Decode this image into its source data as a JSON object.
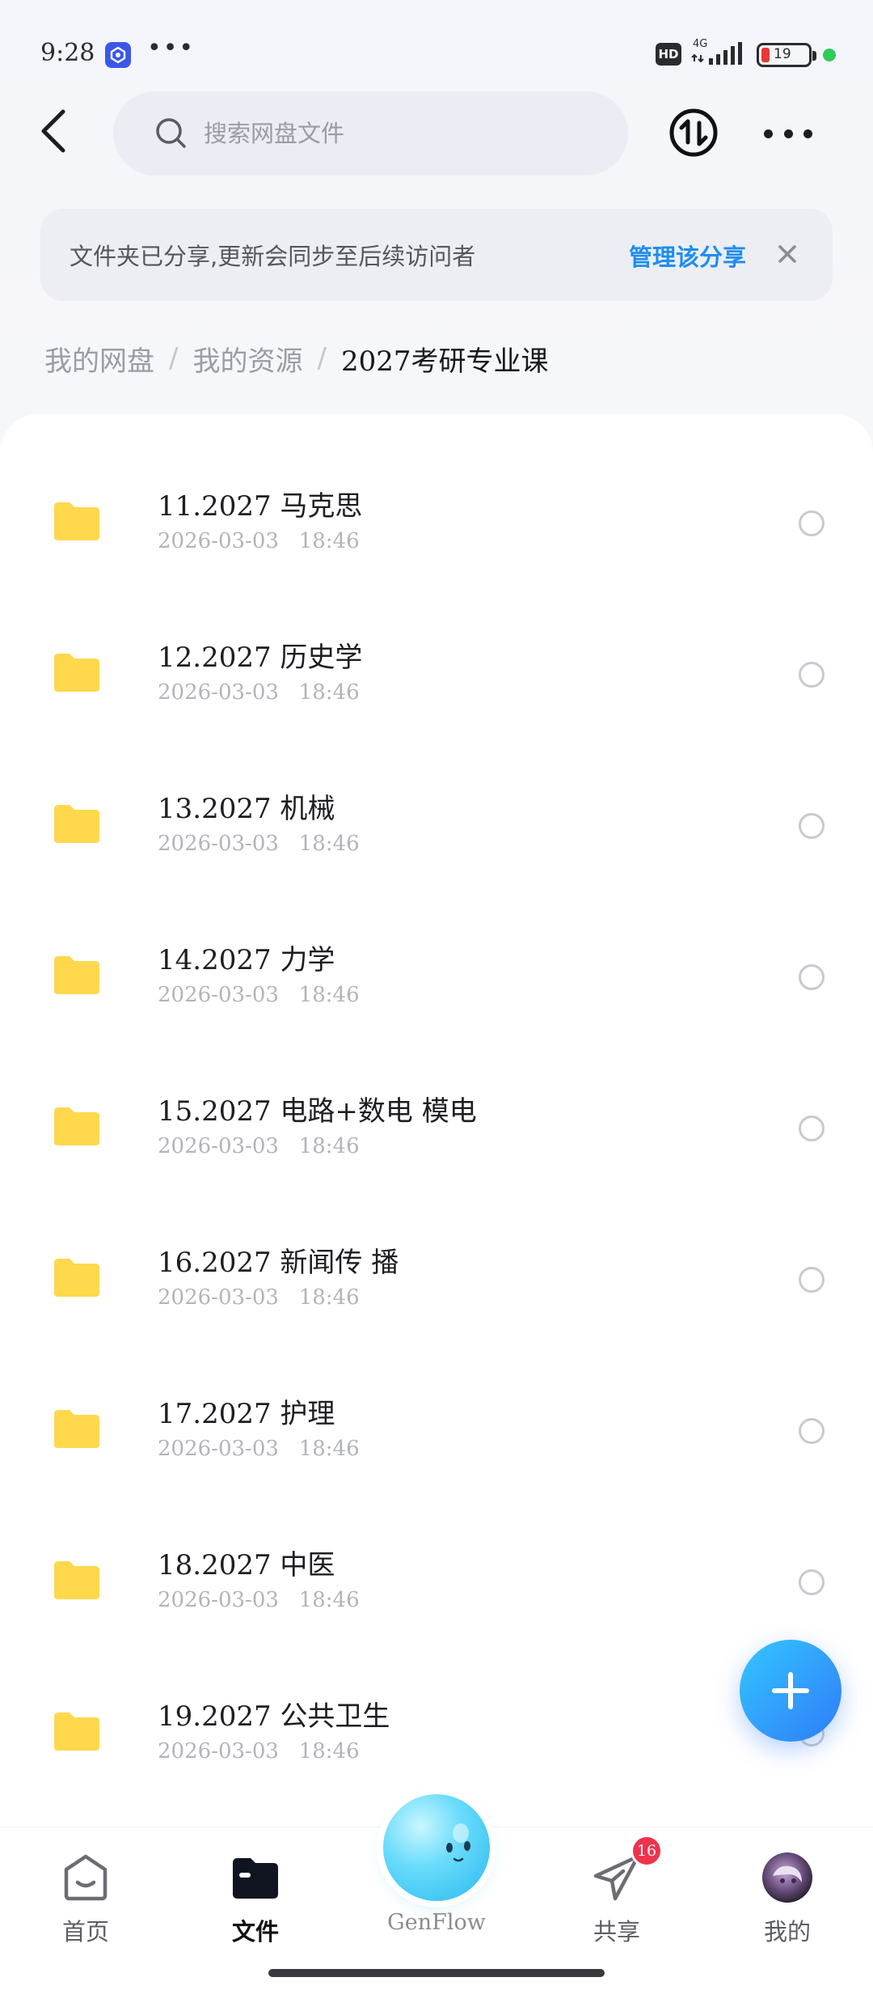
{
  "status_bar": {
    "time": "9:28",
    "dots": "•••",
    "hd": "HD",
    "network": "4G",
    "battery": "19"
  },
  "header": {
    "search_placeholder": "搜索网盘文件"
  },
  "banner": {
    "message": "文件夹已分享,更新会同步至后续访问者",
    "manage_label": "管理该分享"
  },
  "breadcrumb": {
    "items": [
      "我的网盘",
      "我的资源"
    ],
    "separator": "/",
    "current": "2027考研专业课"
  },
  "files": [
    {
      "name": "11.2027 马克思",
      "date": "2026-03-03   18:46"
    },
    {
      "name": "12.2027 历史学",
      "date": "2026-03-03   18:46"
    },
    {
      "name": "13.2027 机械",
      "date": "2026-03-03   18:46"
    },
    {
      "name": "14.2027 力学",
      "date": "2026-03-03   18:46"
    },
    {
      "name": "15.2027 电路+数电 模电",
      "date": "2026-03-03   18:46"
    },
    {
      "name": "16.2027 新闻传 播",
      "date": "2026-03-03   18:46"
    },
    {
      "name": "17.2027 护理",
      "date": "2026-03-03   18:46"
    },
    {
      "name": "18.2027 中医",
      "date": "2026-03-03   18:46"
    },
    {
      "name": "19.2027 公共卫生",
      "date": "2026-03-03   18:46"
    }
  ],
  "bottom_nav": {
    "home": "首页",
    "files": "文件",
    "genflow": "GenFlow",
    "share": "共享",
    "mine": "我的",
    "share_badge": "16"
  },
  "colors": {
    "accent": "#1f8ef0",
    "folder": "#ffd84d",
    "badge": "#f0334d"
  }
}
